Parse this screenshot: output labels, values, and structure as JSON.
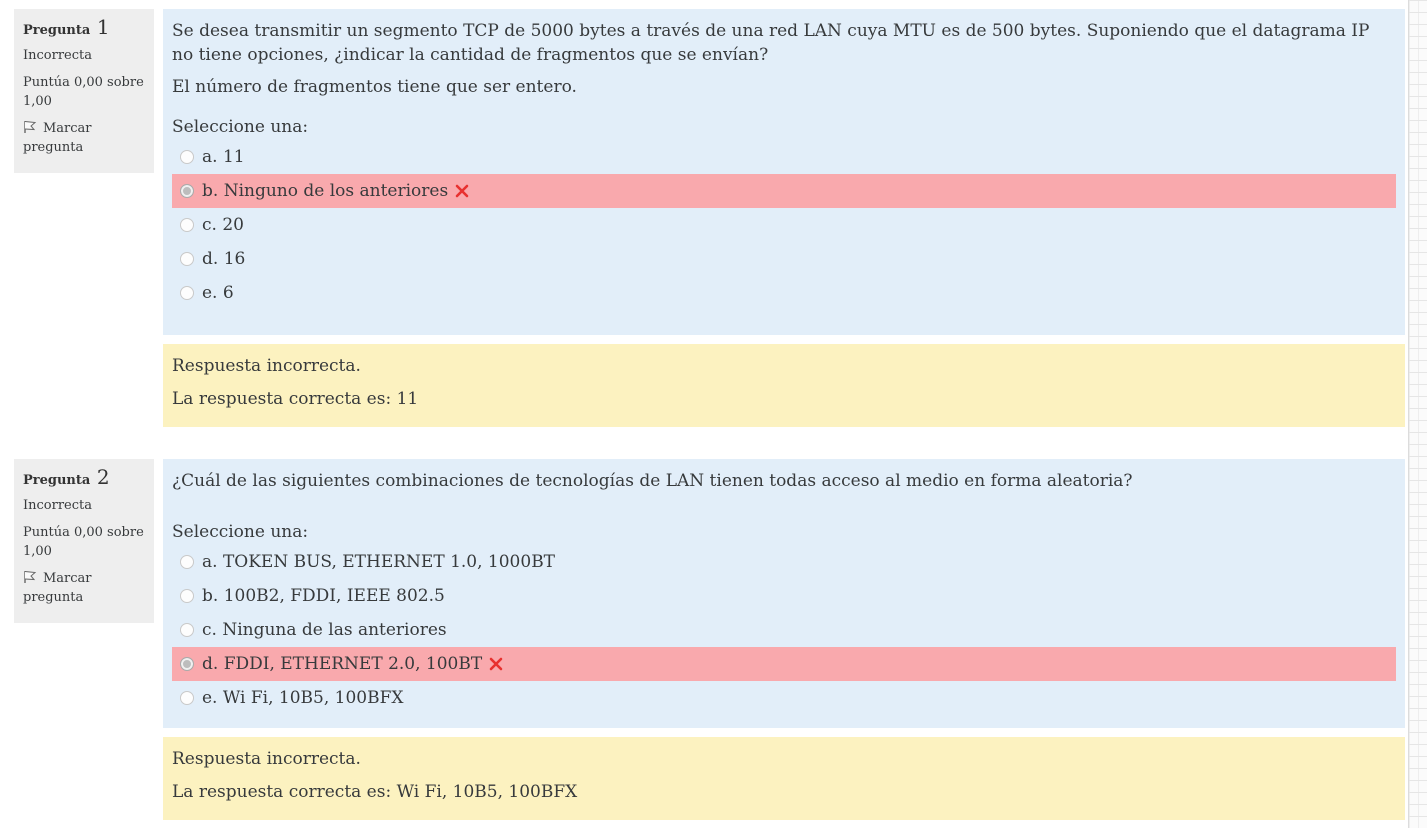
{
  "questions": [
    {
      "label": "Pregunta",
      "number": "1",
      "state": "Incorrecta",
      "grade": "Puntúa 0,00 sobre 1,00",
      "flag_label": "Marcar pregunta",
      "text": "Se desea transmitir un segmento TCP de 5000 bytes a través de una red LAN cuya MTU es de 500 bytes. Suponiendo que el datagrama IP no tiene opciones, ¿indicar la cantidad de fragmentos que se envían?",
      "note": "El número de fragmentos tiene que ser entero.",
      "prompt": "Seleccione una:",
      "options": [
        {
          "label": "a. 11",
          "selected": false
        },
        {
          "label": "b. Ninguno de los anteriores",
          "selected": true,
          "status": "incorrect"
        },
        {
          "label": "c. 20",
          "selected": false
        },
        {
          "label": "d. 16",
          "selected": false
        },
        {
          "label": "e. 6",
          "selected": false
        }
      ],
      "feedback": "Respuesta incorrecta.",
      "correct_answer": "La respuesta correcta es: 11"
    },
    {
      "label": "Pregunta",
      "number": "2",
      "state": "Incorrecta",
      "grade": "Puntúa 0,00 sobre 1,00",
      "flag_label": "Marcar pregunta",
      "text": "¿Cuál de las siguientes combinaciones de tecnologías de LAN tienen todas acceso al medio en forma aleatoria?",
      "prompt": "Seleccione una:",
      "options": [
        {
          "label": "a. TOKEN BUS, ETHERNET 1.0, 1000BT",
          "selected": false
        },
        {
          "label": "b. 100B2, FDDI, IEEE 802.5",
          "selected": false
        },
        {
          "label": "c. Ninguna de las anteriores",
          "selected": false
        },
        {
          "label": "d. FDDI, ETHERNET 2.0, 100BT",
          "selected": true,
          "status": "incorrect"
        },
        {
          "label": "e. Wi Fi, 10B5, 100BFX",
          "selected": false
        }
      ],
      "feedback": "Respuesta incorrecta.",
      "correct_answer": "La respuesta correcta es: Wi Fi, 10B5, 100BFX"
    }
  ],
  "colors": {
    "info_bg": "#eeeeee",
    "question_bg": "#e2eef9",
    "incorrect_bg": "#f9a9ad",
    "feedback_bg": "#fcf2c0",
    "incorrect_mark": "#e8312f"
  },
  "icons": {
    "flag": "flag-icon",
    "incorrect": "incorrect-x-icon",
    "radio": "radio-button"
  }
}
